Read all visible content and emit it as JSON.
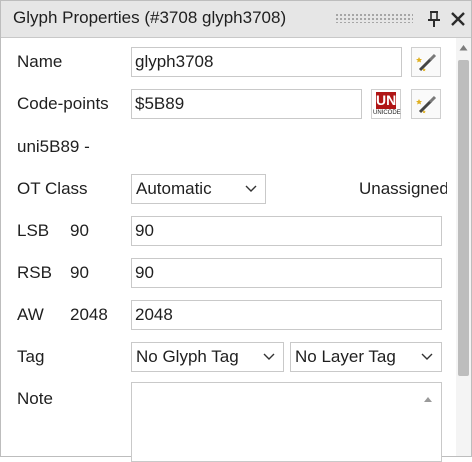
{
  "panel": {
    "title": "Glyph Properties (#3708 glyph3708)"
  },
  "fields": {
    "name_label": "Name",
    "name_value": "glyph3708",
    "codepoints_label": "Code-points",
    "codepoints_value": "$5B89",
    "unicode_name": "uni5B89 -",
    "otclass_label": "OT Class",
    "otclass_value": "Automatic",
    "otclass_status": "Unassigned",
    "lsb_label": "LSB",
    "lsb_current": "90",
    "lsb_value": "90",
    "rsb_label": "RSB",
    "rsb_current": "90",
    "rsb_value": "90",
    "aw_label": "AW",
    "aw_current": "2048",
    "aw_value": "2048",
    "tag_label": "Tag",
    "glyph_tag_value": "No Glyph Tag",
    "layer_tag_value": "No Layer Tag",
    "note_label": "Note",
    "note_value": ""
  },
  "icons": {
    "pin": "pin-icon",
    "close": "close-icon",
    "magic_wand": "magic-wand-icon",
    "unicode_logo": "unicode-logo-icon",
    "dropdown": "chevron-down-icon"
  },
  "unicode_logo": {
    "mark": "UN",
    "word": "UNICODE"
  },
  "colors": {
    "titlebar": "#e6e6e6",
    "unicode_red": "#b01515",
    "border": "#c9c9c9"
  }
}
